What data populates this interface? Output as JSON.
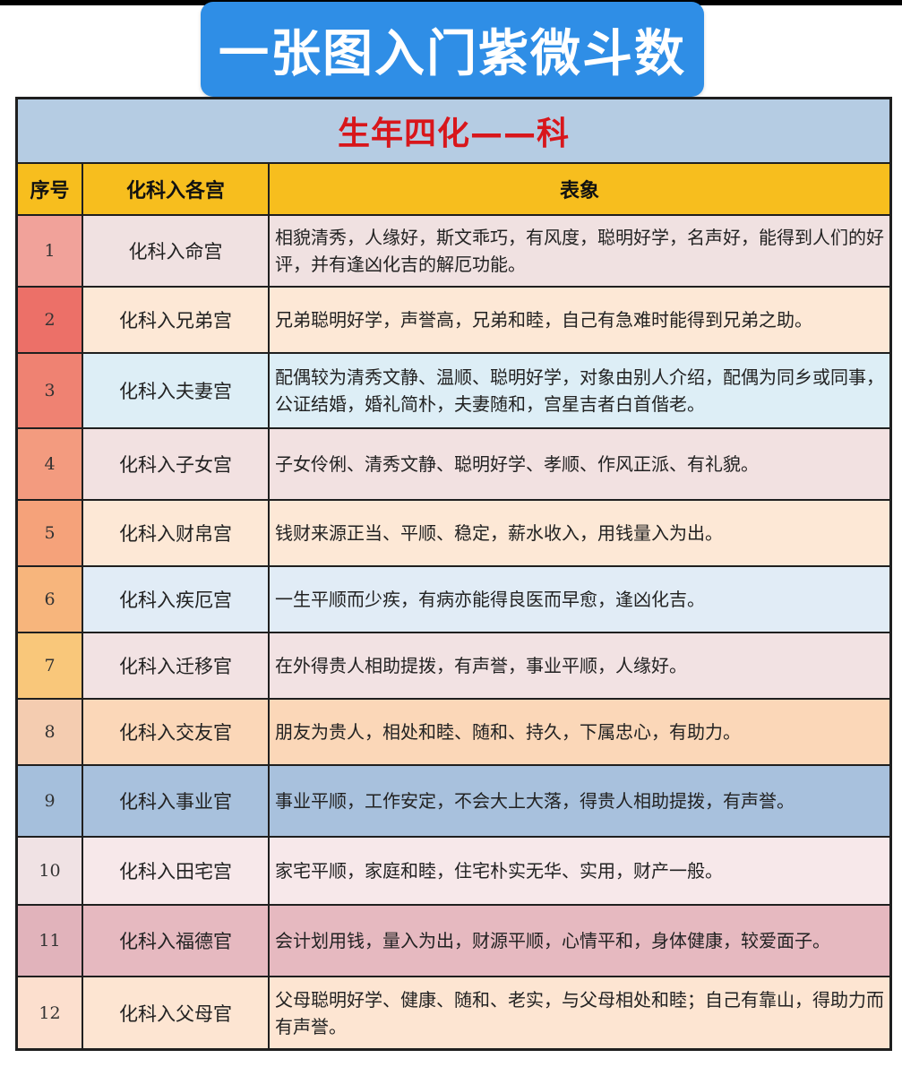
{
  "banner": {
    "title": "一张图入门紫微斗数"
  },
  "table": {
    "title": "生年四化——科",
    "headers": {
      "index": "序号",
      "palace": "化科入各宫",
      "meaning": "表象"
    },
    "rows": [
      {
        "index": "1",
        "palace": "化科入命宫",
        "meaning": "相貌清秀，人缘好，斯文乖巧，有风度，聪明好学，名声好，能得到人们的好评，并有逢凶化吉的解厄功能。"
      },
      {
        "index": "2",
        "palace": "化科入兄弟宫",
        "meaning": "兄弟聪明好学，声誉高，兄弟和睦，自己有急难时能得到兄弟之助。"
      },
      {
        "index": "3",
        "palace": "化科入夫妻宫",
        "meaning": "配偶较为清秀文静、温顺、聪明好学，对象由别人介绍，配偶为同乡或同事，公证结婚，婚礼简朴，夫妻随和，宫星吉者白首偕老。"
      },
      {
        "index": "4",
        "palace": "化科入子女宫",
        "meaning": "子女伶俐、清秀文静、聪明好学、孝顺、作风正派、有礼貌。"
      },
      {
        "index": "5",
        "palace": "化科入财帛宫",
        "meaning": "钱财来源正当、平顺、稳定，薪水收入，用钱量入为出。"
      },
      {
        "index": "6",
        "palace": "化科入疾厄宫",
        "meaning": "一生平顺而少疾，有病亦能得良医而早愈，逢凶化吉。"
      },
      {
        "index": "7",
        "palace": "化科入迁移官",
        "meaning": "在外得贵人相助提拨，有声誉，事业平顺，人缘好。"
      },
      {
        "index": "8",
        "palace": "化科入交友官",
        "meaning": "朋友为贵人，相处和睦、随和、持久，下属忠心，有助力。"
      },
      {
        "index": "9",
        "palace": "化科入事业官",
        "meaning": "事业平顺，工作安定，不会大上大落，得贵人相助提拨，有声誉。"
      },
      {
        "index": "10",
        "palace": "化科入田宅宫",
        "meaning": "家宅平顺，家庭和睦，住宅朴实无华、实用，财产一般。"
      },
      {
        "index": "11",
        "palace": "化科入福德官",
        "meaning": "会计划用钱，量入为出，财源平顺，心情平和，身体健康，较爱面子。"
      },
      {
        "index": "12",
        "palace": "化科入父母官",
        "meaning": "父母聪明好学、健康、随和、老实，与父母相处和睦；自己有靠山，得助力而有声誉。"
      }
    ]
  },
  "colors": {
    "banner": "#2f8ee6",
    "title_band": "#b5cce3",
    "title_text": "#d8161b",
    "header": "#f7be1e",
    "index_cells": [
      "#f1a29a",
      "#ec7068",
      "#ef8272",
      "#f39b7f",
      "#f5a27a",
      "#f7b57c",
      "#f9c77a",
      "#f4ccb0",
      "#a5bfdc",
      "#f0e2e4",
      "#e1b3bb",
      "#fcdfce"
    ],
    "row_cells": [
      "#f0e1e1",
      "#fde8d6",
      "#ddeef6",
      "#f2e1e1",
      "#fde8d6",
      "#e1ecf6",
      "#f2e2e3",
      "#fbd7b8",
      "#a8c1dd",
      "#f7e8ea",
      "#e6b9c0",
      "#fde5d2"
    ]
  }
}
